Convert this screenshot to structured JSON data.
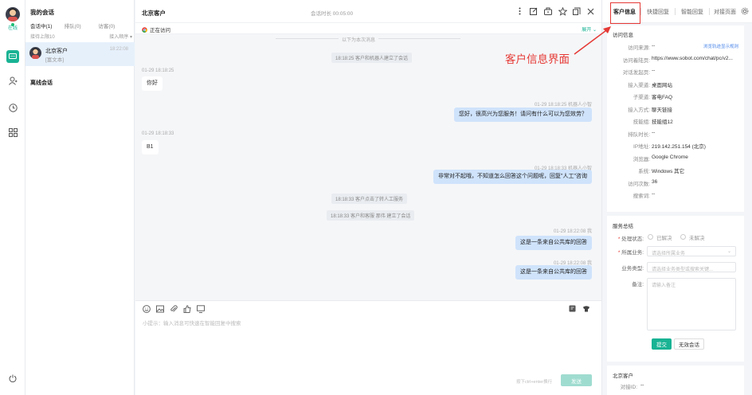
{
  "rail": {
    "status": "在线",
    "items": [
      "chat",
      "contacts",
      "history",
      "apps"
    ]
  },
  "session_list": {
    "title": "我的会话",
    "tabs": [
      "会话中(1)",
      "排队(0)",
      "访客(0)"
    ],
    "limit": "接待上限10",
    "order": "接入顺序",
    "active_session": {
      "name": "北京客户",
      "preview": "[富文本]",
      "time": "18:22:08"
    },
    "offline_title": "离线会话"
  },
  "chat": {
    "title": "北京客户",
    "duration": "会话时长 00:05:00",
    "visiting": "正在访问",
    "expand": "展开",
    "divider": "以下为本次消息",
    "messages": [
      {
        "kind": "sys",
        "text": "18:18:25 客户和机器人建立了会话"
      },
      {
        "kind": "left",
        "meta": "01-29 18:18:25",
        "text": "你好"
      },
      {
        "kind": "right",
        "meta": "01-29 18:18:25  机器人小智",
        "text": "您好，很高兴为您服务！请问有什么可以为您效劳？"
      },
      {
        "kind": "left",
        "meta": "01-29 18:18:33",
        "text": "B1"
      },
      {
        "kind": "right",
        "meta": "01-29 18:18:33  机器人小智",
        "text": "非常对不起哦，不知道怎么回答这个问题呢，回复\"人工\"咨询"
      },
      {
        "kind": "sys",
        "text": "18:18:33 客户点击了转人工服务"
      },
      {
        "kind": "sys",
        "text": "18:18:33 客户和客服 那伟 建立了会话"
      },
      {
        "kind": "right",
        "meta": "01-29 18:22:08  我",
        "text": "这是一条来自公共库的回答"
      },
      {
        "kind": "right",
        "meta": "01-29 18:22:08  我",
        "text": "这是一条来自公共库的回答"
      }
    ],
    "input_placeholder": "小提示：输入消息可快速在智能回复中搜索",
    "send_hint": "按下ctrl+enter换行",
    "send": "发送"
  },
  "right_panel": {
    "tabs": [
      "客户信息",
      "快捷回复",
      "智能回复",
      "对接页面"
    ],
    "visit_title": "访问信息",
    "view_trail": "浏览轨迹显示规则",
    "visit_rows": [
      {
        "k": "访问来源:",
        "v": "--"
      },
      {
        "k": "访问着陆页:",
        "v": "https://www.sobot.com/chat/pc/v2..."
      },
      {
        "k": "对话发起页:",
        "v": "--"
      },
      {
        "k": "接入渠道:",
        "v": "桌面网站"
      },
      {
        "k": "子渠道:",
        "v": "客电FAQ"
      },
      {
        "k": "接入方式:",
        "v": "聊天链接"
      },
      {
        "k": "技能组:",
        "v": "技能组12"
      },
      {
        "k": "排队时长:",
        "v": "--"
      },
      {
        "k": "IP地址:",
        "v": "219.142.251.154 (北京)"
      },
      {
        "k": "浏览器:",
        "v": "Google Chrome"
      },
      {
        "k": "系统:",
        "v": "Windows 其它"
      },
      {
        "k": "访问次数:",
        "v": "36"
      },
      {
        "k": "搜索词:",
        "v": "--"
      }
    ],
    "summary": {
      "title": "服务总结",
      "status_label": "处理状态:",
      "status_options": [
        "已解决",
        "未解决"
      ],
      "biz_label": "所属业务:",
      "biz_placeholder": "请选择所属业务",
      "type_label": "业务类型:",
      "type_placeholder": "请选择业务类型或搜索关键...",
      "note_label": "备注:",
      "note_placeholder": "请输入备注",
      "submit": "提交",
      "invalid": "无效会话"
    },
    "customer": {
      "name": "北京客户",
      "id_label": "对接ID:",
      "id_value": "--"
    }
  },
  "annotation": {
    "text": "客户信息界面",
    "color": "#e53935"
  },
  "colors": {
    "accent": "#19b394",
    "bubble_right": "#cfe3fb",
    "selected_row": "#e6f0fb"
  }
}
